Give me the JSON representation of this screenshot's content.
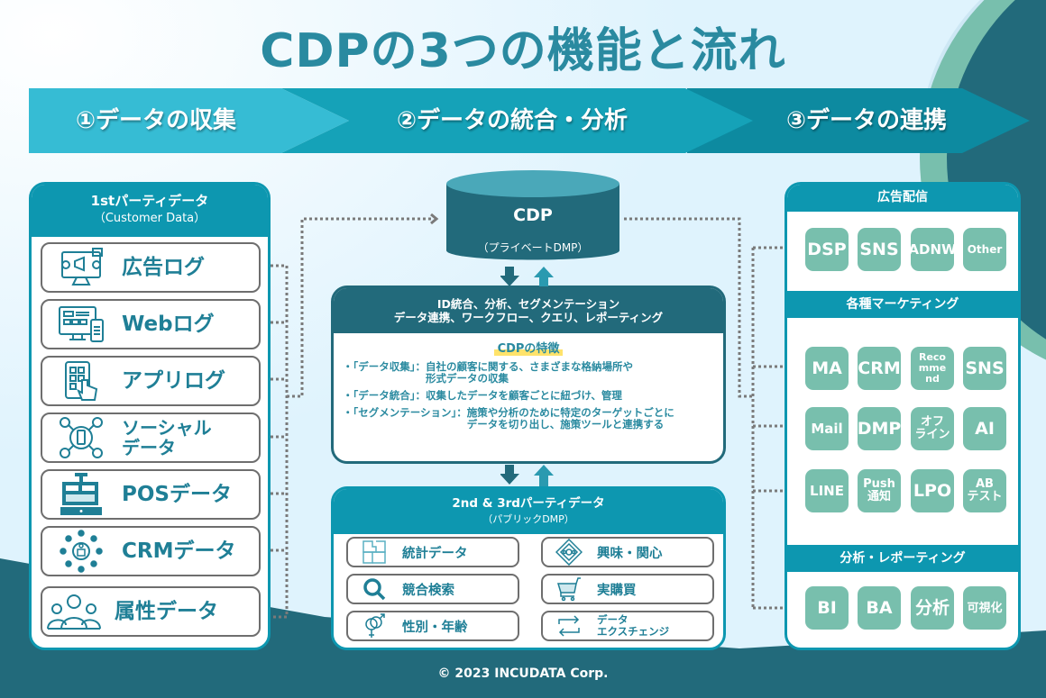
{
  "title": "CDPの3つの機能と流れ",
  "steps": [
    {
      "label": "①データの収集"
    },
    {
      "label": "②データの統合・分析"
    },
    {
      "label": "③データの連携"
    }
  ],
  "first_party": {
    "title": "1stパーティデータ",
    "subtitle": "（Customer Data）",
    "items": [
      {
        "label": "広告ログ",
        "icon": "ad-monitor-icon"
      },
      {
        "label": "Webログ",
        "icon": "web-devices-icon"
      },
      {
        "label": "アプリログ",
        "icon": "tablet-tap-icon"
      },
      {
        "label": "ソーシャル\nデータ",
        "icon": "social-network-icon"
      },
      {
        "label": "POSデータ",
        "icon": "cash-register-icon"
      },
      {
        "label": "CRMデータ",
        "icon": "crm-hub-icon"
      },
      {
        "label": "属性データ",
        "icon": "people-group-icon"
      }
    ]
  },
  "cdp": {
    "title": "CDP",
    "subtitle": "（プライベートDMP）"
  },
  "functions": {
    "line1": "ID統合、分析、セグメンテーション",
    "line2": "データ連携、ワークフロー、クエリ、レポーティング",
    "features_title": "CDPの特徴",
    "features": [
      {
        "key": "・「データ収集」：",
        "value": "自社の顧客に関する、さまざまな格納場所や\n形式データの収集"
      },
      {
        "key": "・「データ統合」：",
        "value": "収集したデータを顧客ごとに紐づけ、管理"
      },
      {
        "key": "・「セグメンテーション」：",
        "value": "施策や分析のために特定のターゲットごとに\nデータを切り出し、施策ツールと連携する"
      }
    ]
  },
  "public_dmp": {
    "title": "2nd & 3rdパーティデータ",
    "subtitle": "（パブリックDMP）",
    "items": [
      {
        "label": "統計データ",
        "icon": "puzzle-icon"
      },
      {
        "label": "興味・関心",
        "icon": "interest-diamond-icon"
      },
      {
        "label": "競合検索",
        "icon": "search-icon"
      },
      {
        "label": "実購買",
        "icon": "shopping-cart-icon"
      },
      {
        "label": "性別・年齢",
        "icon": "gender-icon"
      },
      {
        "label": "データ\nエクスチェンジ",
        "icon": "exchange-arrows-icon"
      }
    ]
  },
  "integrations": {
    "sections": [
      {
        "title": "広告配信",
        "tiles": [
          "DSP",
          "SNS",
          "ADNW",
          "Other"
        ]
      },
      {
        "title": "各種マーケティング",
        "tiles": [
          "MA",
          "CRM",
          "Reco\nmme\nnd",
          "SNS",
          "Mail",
          "DMP",
          "オフ\nライン",
          "AI",
          "LINE",
          "Push\n通知",
          "LPO",
          "AB\nテスト"
        ]
      },
      {
        "title": "分析・レポーティング",
        "tiles": [
          "BI",
          "BA",
          "分析",
          "可視化"
        ]
      }
    ]
  },
  "footer": "© 2023 INCUDATA Corp.",
  "colors": {
    "background": "#dff3fd",
    "primary": "#0d97b0",
    "dark": "#226a7b",
    "tile": "#78bfad",
    "step1": "#36bcd4",
    "step2": "#15a2b8",
    "step3": "#0d8aa0",
    "highlight": "#ffe36b"
  }
}
